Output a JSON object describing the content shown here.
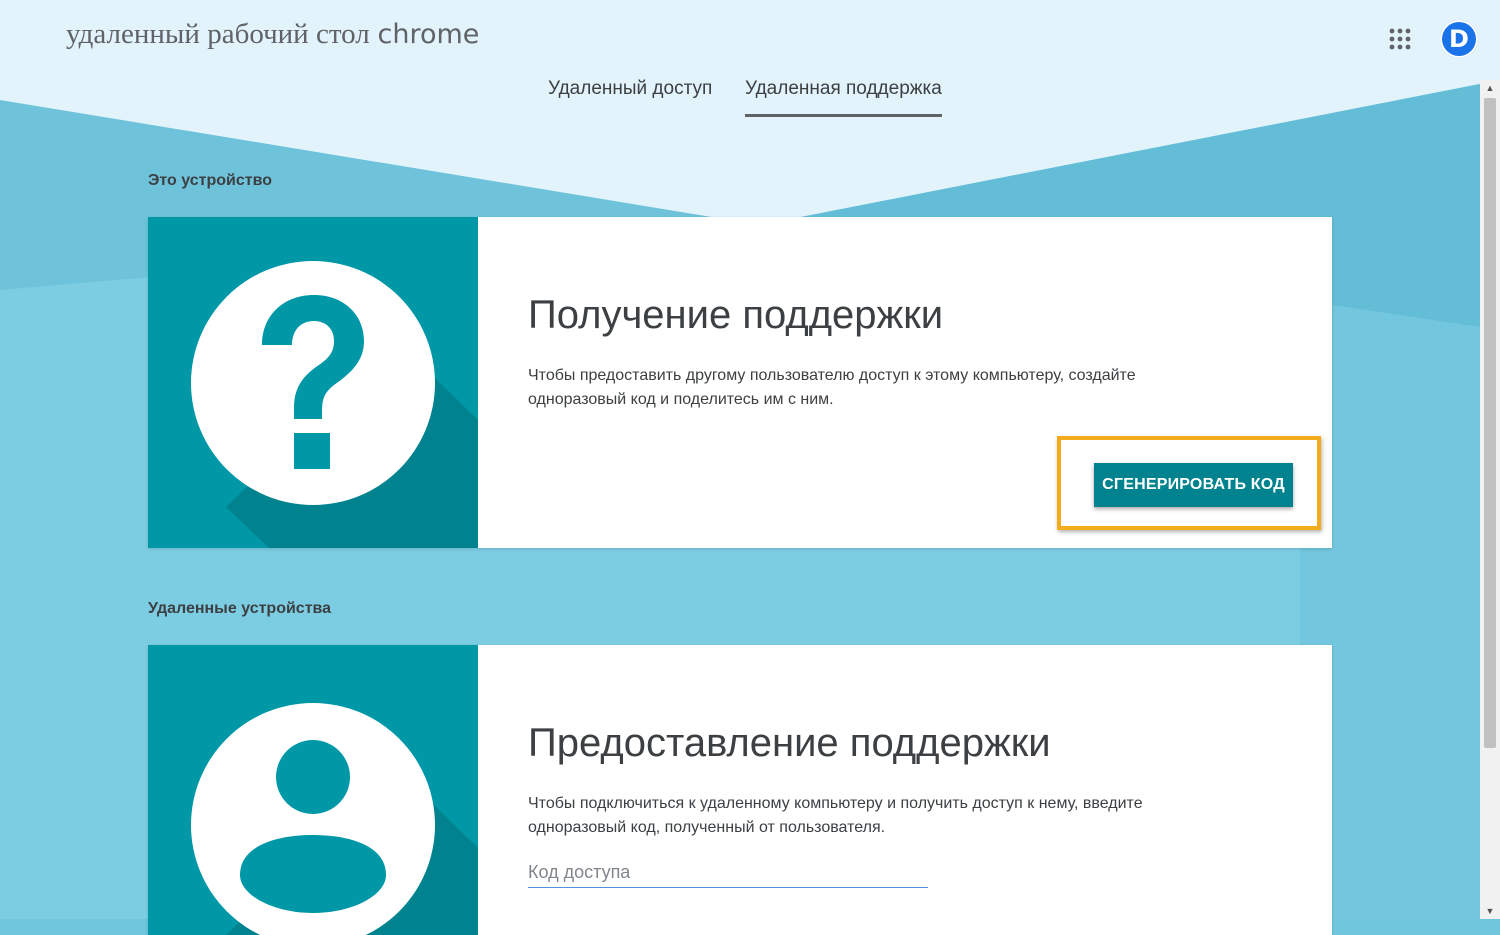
{
  "header": {
    "logo_text": "удаленный рабочий стол",
    "logo_brand": "chrome",
    "apps_icon": "apps-grid-icon",
    "avatar_letter": "D"
  },
  "tabs": [
    {
      "label": "Удаленный доступ",
      "active": false
    },
    {
      "label": "Удаленная поддержка",
      "active": true
    }
  ],
  "sections": {
    "this_device_label": "Это устройство",
    "remote_devices_label": "Удаленные устройства"
  },
  "get_support": {
    "title": "Получение поддержки",
    "description": "Чтобы предоставить другому пользователю доступ к этому компьютеру, создайте одноразовый код и поделитесь им с ним.",
    "button_label": "СГЕНЕРИРОВАТЬ КОД",
    "icon": "question-mark-icon"
  },
  "give_support": {
    "title": "Предоставление поддержки",
    "description": "Чтобы подключиться к удаленному компьютеру и получить доступ к нему, введите одноразовый код, полученный от пользователя.",
    "input_placeholder": "Код доступа",
    "input_value": "",
    "icon": "person-icon"
  },
  "colors": {
    "teal": "#0097a7",
    "teal_dark": "#00838f",
    "highlight": "#f5ac1c",
    "background": "#6fc6dd"
  }
}
